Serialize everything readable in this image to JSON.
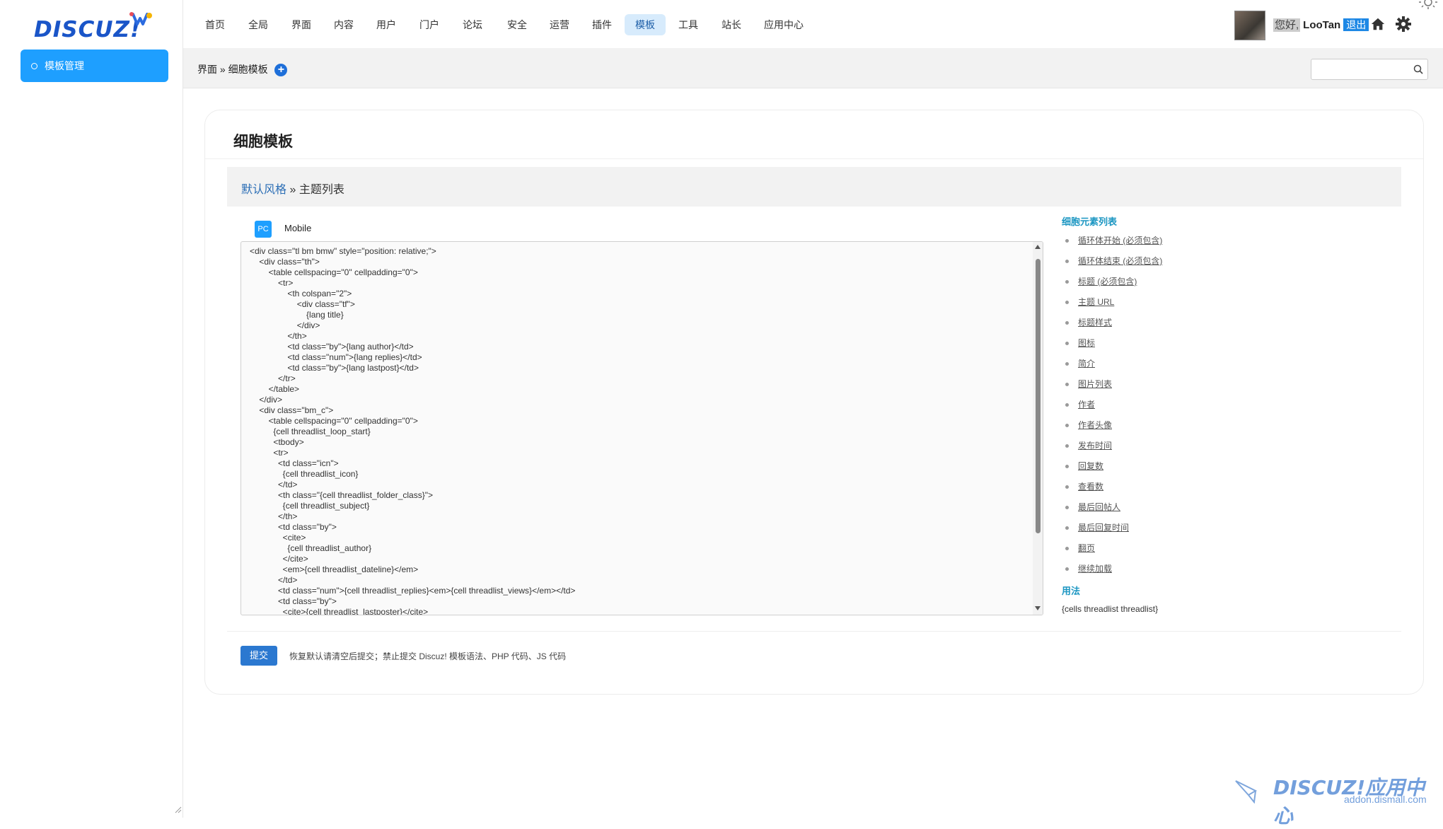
{
  "logo": {
    "text": "DISCUZ!"
  },
  "sidebar": {
    "items": [
      {
        "label": "模板管理"
      }
    ]
  },
  "nav": {
    "items": [
      "首页",
      "全局",
      "界面",
      "内容",
      "用户",
      "门户",
      "论坛",
      "安全",
      "运营",
      "插件",
      "模板",
      "工具",
      "站长",
      "应用中心"
    ],
    "active": "模板"
  },
  "user": {
    "greeting": "您好,",
    "name": "LooTan",
    "logout": "退出"
  },
  "breadcrumb": {
    "section": "界面",
    "sep": "»",
    "page": "细胞模板",
    "add": "+"
  },
  "search": {
    "placeholder": ""
  },
  "card": {
    "title": "细胞模板",
    "subhead": {
      "link": "默认风格",
      "sep": "»",
      "current": "主题列表"
    },
    "tabs": {
      "pc": "PC",
      "mobile": "Mobile"
    },
    "code": "<div class=\"tl bm bmw\" style=\"position: relative;\">\n\t<div class=\"th\">\n\t\t<table cellspacing=\"0\" cellpadding=\"0\">\n\t\t\t<tr>\n\t\t\t\t<th colspan=\"2\">\n\t\t\t\t\t<div class=\"tf\">\n\t\t\t\t\t\t{lang title}\n\t\t\t\t\t</div>\n\t\t\t\t</th>\n\t\t\t\t<td class=\"by\">{lang author}</td>\n\t\t\t\t<td class=\"num\">{lang replies}</td>\n\t\t\t\t<td class=\"by\">{lang lastpost}</td>\n\t\t\t</tr>\n\t\t</table>\n\t</div>\n\t<div class=\"bm_c\">\n\t\t<table cellspacing=\"0\" cellpadding=\"0\">\n\t\t  {cell threadlist_loop_start}\n\t\t  <tbody>\n\t\t  <tr>\n\t\t\t<td class=\"icn\">\n\t\t\t  {cell threadlist_icon}\n\t\t\t</td>\n\t\t\t<th class=\"{cell threadlist_folder_class}\">\n\t\t\t  {cell threadlist_subject}\n\t\t\t</th>\n\t\t\t<td class=\"by\">\n\t\t\t  <cite>\n\t\t\t\t{cell threadlist_author}\n\t\t\t  </cite>\n\t\t\t  <em>{cell threadlist_dateline}</em>\n\t\t\t</td>\n\t\t\t<td class=\"num\">{cell threadlist_replies}<em>{cell threadlist_views}</em></td>\n\t\t\t<td class=\"by\">\n\t\t\t  <cite>{cell threadlist_lastposter}</cite>",
    "cells_title": "细胞元素列表",
    "cells": [
      "循环体开始 (必须包含)",
      "循环体结束 (必须包含)",
      "标题 (必须包含)",
      "主题 URL",
      "标题样式",
      "图标",
      "简介",
      "图片列表",
      "作者",
      "作者头像",
      "发布时间",
      "回复数",
      "查看数",
      "最后回帖人",
      "最后回复时间",
      "翻页",
      "继续加载"
    ],
    "usage_title": "用法",
    "usage_code": "{cells threadlist threadlist}",
    "submit": "提交",
    "submit_note": "恢复默认请清空后提交；禁止提交 Discuz! 模板语法、PHP 代码、JS 代码"
  },
  "watermark": {
    "text": "DISCUZ!应用中心",
    "url": "addon.dismall.com"
  },
  "colors": {
    "accent": "#1e9fff",
    "link": "#2a6db5",
    "button": "#2b78d0",
    "cell_title": "#1b96c2"
  },
  "icons": [
    "home-icon",
    "gear-icon",
    "search-icon",
    "add-icon",
    "sun-icon"
  ]
}
